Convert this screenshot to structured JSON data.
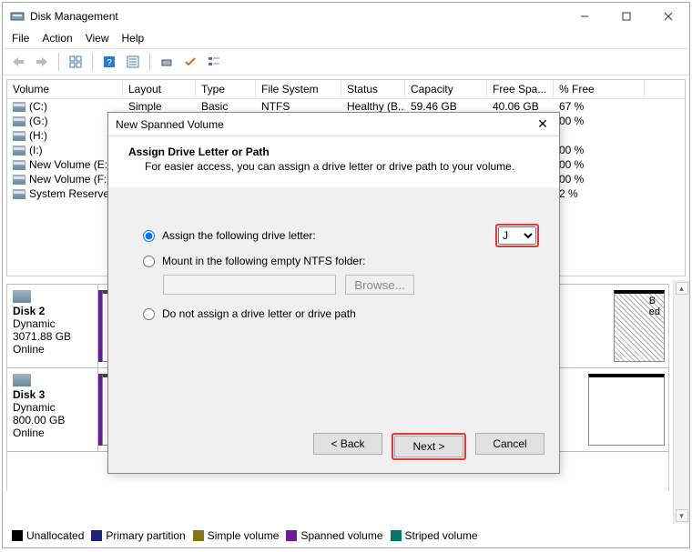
{
  "titlebar": {
    "title": "Disk Management"
  },
  "menu": {
    "file": "File",
    "action": "Action",
    "view": "View",
    "help": "Help"
  },
  "columns": {
    "volume": "Volume",
    "layout": "Layout",
    "type": "Type",
    "fs": "File System",
    "status": "Status",
    "capacity": "Capacity",
    "free": "Free Spa...",
    "pct": "% Free"
  },
  "rows": [
    {
      "vol": "(C:)",
      "layout": "Simple",
      "type": "Basic",
      "fs": "NTFS",
      "status": "Healthy (B...",
      "cap": "59.46 GB",
      "free": "40.06 GB",
      "pct": "67 %"
    },
    {
      "vol": "(G:)",
      "layout": "",
      "type": "",
      "fs": "",
      "status": "",
      "cap": "",
      "free": "",
      "pct": "00 %"
    },
    {
      "vol": "(H:)",
      "layout": "",
      "type": "",
      "fs": "",
      "status": "",
      "cap": "",
      "free": "",
      "pct": ""
    },
    {
      "vol": "(I:)",
      "layout": "",
      "type": "",
      "fs": "",
      "status": "",
      "cap": "",
      "free": "",
      "pct": "00 %"
    },
    {
      "vol": "New Volume (E:)",
      "layout": "",
      "type": "",
      "fs": "",
      "status": "",
      "cap": "",
      "free": "",
      "pct": "00 %"
    },
    {
      "vol": "New Volume (F:)",
      "layout": "",
      "type": "",
      "fs": "",
      "status": "",
      "cap": "",
      "free": "",
      "pct": "00 %"
    },
    {
      "vol": "System Reserved",
      "layout": "",
      "type": "",
      "fs": "",
      "status": "",
      "cap": "",
      "free": "",
      "pct": "2 %"
    }
  ],
  "disks": [
    {
      "name": "Disk 2",
      "dyn": "Dynamic",
      "size": "3071.88 GB",
      "state": "Online",
      "tail": "B\ned"
    },
    {
      "name": "Disk 3",
      "dyn": "Dynamic",
      "size": "800.00 GB",
      "state": "Online",
      "tail": ""
    }
  ],
  "legend": {
    "items": [
      {
        "label": "Unallocated",
        "color": "#000000"
      },
      {
        "label": "Primary partition",
        "color": "#1a237e"
      },
      {
        "label": "Simple volume",
        "color": "#827717"
      },
      {
        "label": "Spanned volume",
        "color": "#6a1b9a"
      },
      {
        "label": "Striped volume",
        "color": "#00796b"
      }
    ]
  },
  "dialog": {
    "title": "New Spanned Volume",
    "heading": "Assign Drive Letter or Path",
    "sub": "For easier access, you can assign a drive letter or drive path to your volume.",
    "opt1": "Assign the following drive letter:",
    "opt2": "Mount in the following empty NTFS folder:",
    "opt3": "Do not assign a drive letter or drive path",
    "letter": "J",
    "browse": "Browse...",
    "back": "< Back",
    "next": "Next >",
    "cancel": "Cancel"
  }
}
